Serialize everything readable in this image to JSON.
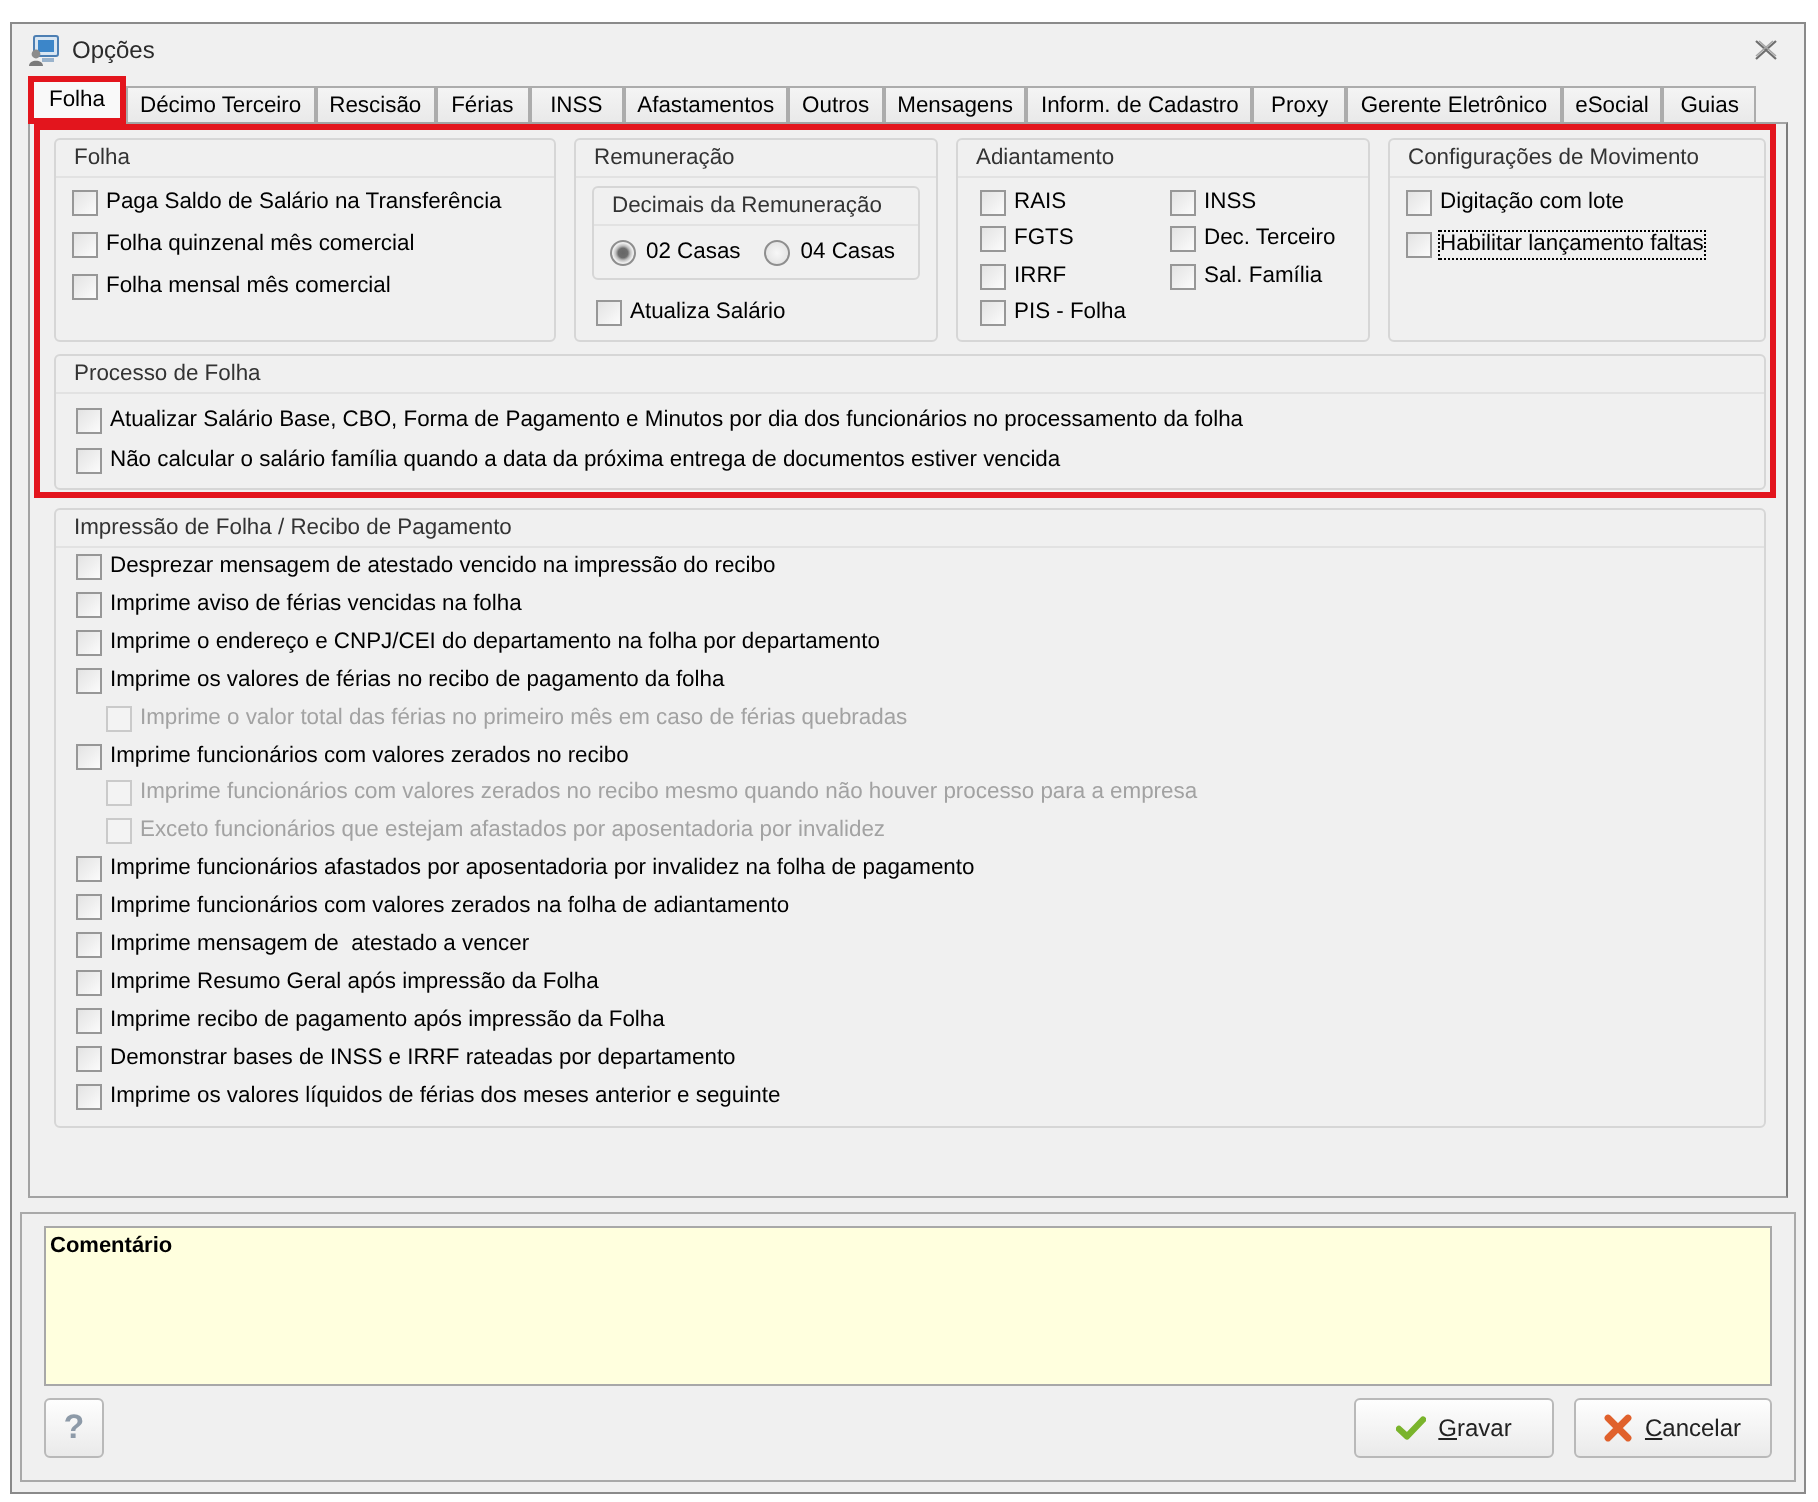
{
  "window": {
    "title": "Opções"
  },
  "tabs": [
    {
      "label": "Folha",
      "selected": true,
      "highlighted": true
    },
    {
      "label": "Décimo Terceiro",
      "selected": false,
      "highlighted": false
    },
    {
      "label": "Rescisão",
      "selected": false,
      "highlighted": false
    },
    {
      "label": "Férias",
      "selected": false,
      "highlighted": false
    },
    {
      "label": "INSS",
      "selected": false,
      "highlighted": false
    },
    {
      "label": "Afastamentos",
      "selected": false,
      "highlighted": false
    },
    {
      "label": "Outros",
      "selected": false,
      "highlighted": false
    },
    {
      "label": "Mensagens",
      "selected": false,
      "highlighted": false
    },
    {
      "label": "Inform. de Cadastro",
      "selected": false,
      "highlighted": false
    },
    {
      "label": "Proxy",
      "selected": false,
      "highlighted": false
    },
    {
      "label": "Gerente Eletrônico",
      "selected": false,
      "highlighted": false
    },
    {
      "label": "eSocial",
      "selected": false,
      "highlighted": false
    },
    {
      "label": "Guias",
      "selected": false,
      "highlighted": false
    }
  ],
  "top_section": {
    "highlighted": true,
    "folha": {
      "title": "Folha",
      "options": [
        {
          "label": "Paga Saldo de Salário na Transferência",
          "checked": false
        },
        {
          "label": "Folha quinzenal mês comercial",
          "checked": false
        },
        {
          "label": "Folha mensal mês comercial",
          "checked": false
        }
      ]
    },
    "remuneracao": {
      "title": "Remuneração",
      "decimais": {
        "title": "Decimais da Remuneração",
        "options": [
          {
            "label": "02 Casas",
            "selected": true
          },
          {
            "label": "04 Casas",
            "selected": false
          }
        ]
      },
      "options": [
        {
          "label": "Atualiza Salário",
          "checked": false
        }
      ]
    },
    "adiantamento": {
      "title": "Adiantamento",
      "columns": [
        {
          "options": [
            {
              "label": "RAIS",
              "checked": false
            },
            {
              "label": "FGTS",
              "checked": false
            },
            {
              "label": "IRRF",
              "checked": false
            },
            {
              "label": "PIS - Folha",
              "checked": false
            }
          ]
        },
        {
          "options": [
            {
              "label": "INSS",
              "checked": false
            },
            {
              "label": "Dec. Terceiro",
              "checked": false
            },
            {
              "label": "Sal. Família",
              "checked": false
            }
          ]
        }
      ]
    },
    "configuracoes_movimento": {
      "title": "Configurações de Movimento",
      "options": [
        {
          "label": "Digitação com lote",
          "checked": false,
          "focused": false
        },
        {
          "label": "Habilitar lançamento faltas",
          "checked": false,
          "focused": true
        }
      ]
    },
    "processo": {
      "title": "Processo de Folha",
      "options": [
        {
          "label": "Atualizar Salário Base, CBO, Forma de Pagamento e Minutos por dia dos funcionários no processamento da folha",
          "checked": false
        },
        {
          "label": "Não calcular o salário família quando a data da próxima entrega de documentos estiver vencida",
          "checked": false
        }
      ]
    }
  },
  "impressao": {
    "title": "Impressão de Folha / Recibo de Pagamento",
    "options": [
      {
        "label": "Desprezar mensagem de atestado vencido na impressão do recibo",
        "checked": false,
        "disabled": false
      },
      {
        "label": "Imprime aviso de férias vencidas na folha",
        "checked": false,
        "disabled": false
      },
      {
        "label": "Imprime o endereço e CNPJ/CEI do departamento na folha por departamento",
        "checked": false,
        "disabled": false
      },
      {
        "label": "Imprime os valores de férias no recibo de pagamento da folha",
        "checked": false,
        "disabled": false,
        "children": [
          {
            "label": "Imprime o valor total das férias no primeiro mês em caso de férias quebradas",
            "checked": false,
            "disabled": true
          }
        ]
      },
      {
        "label": "Imprime funcionários com valores zerados no recibo",
        "checked": false,
        "disabled": false,
        "children": [
          {
            "label": "Imprime funcionários com valores zerados no recibo mesmo quando não houver processo para a empresa",
            "checked": false,
            "disabled": true
          },
          {
            "label": "Exceto funcionários que estejam afastados por aposentadoria por invalidez",
            "checked": false,
            "disabled": true
          }
        ]
      },
      {
        "label": "Imprime funcionários afastados por aposentadoria por invalidez na folha de pagamento",
        "checked": false,
        "disabled": false
      },
      {
        "label": "Imprime funcionários com valores zerados na folha de adiantamento",
        "checked": false,
        "disabled": false
      },
      {
        "label": "Imprime mensagem de  atestado a vencer",
        "checked": false,
        "disabled": false
      },
      {
        "label": "Imprime Resumo Geral após impressão da Folha",
        "checked": false,
        "disabled": false
      },
      {
        "label": "Imprime recibo de pagamento após impressão da Folha",
        "checked": false,
        "disabled": false
      },
      {
        "label": "Demonstrar bases de INSS e IRRF rateadas por departamento",
        "checked": false,
        "disabled": false
      },
      {
        "label": "Imprime os valores líquidos de férias dos meses anterior e seguinte",
        "checked": false,
        "disabled": false
      }
    ]
  },
  "comment": {
    "label": "Comentário"
  },
  "footer": {
    "help": {
      "label": "?"
    },
    "actions": [
      {
        "label": "Gravar",
        "kind": "confirm",
        "mnemonic_underlined": true
      },
      {
        "label": "Cancelar",
        "kind": "cancel",
        "mnemonic_underlined": true
      }
    ]
  }
}
